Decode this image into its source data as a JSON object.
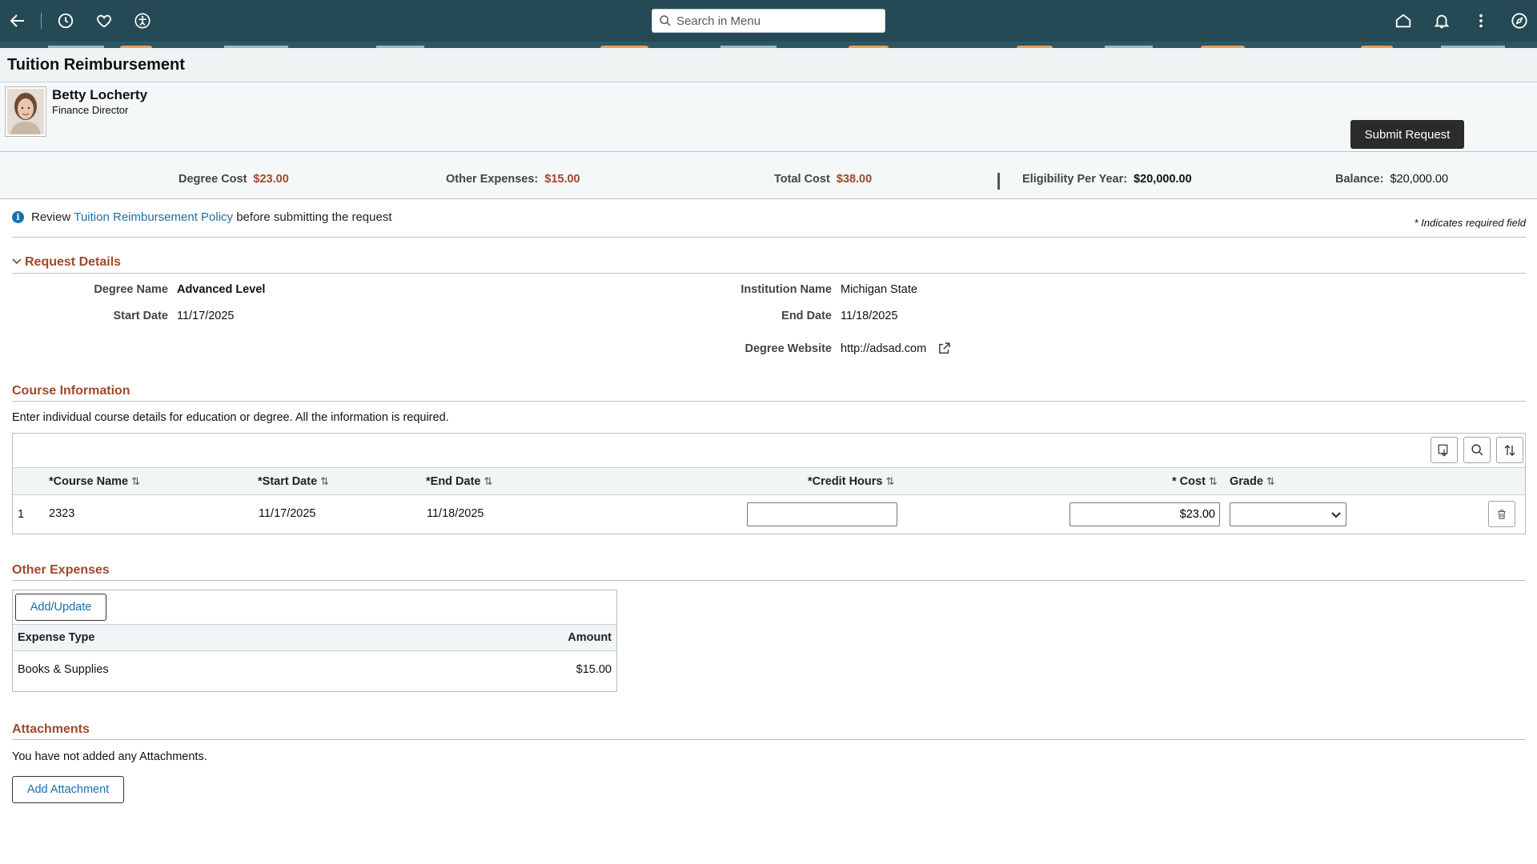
{
  "topbar": {
    "search_placeholder": "Search in Menu",
    "icons": [
      "back-arrow-icon",
      "history-icon",
      "favorites-heart-icon",
      "accessibility-icon",
      "home-icon",
      "notifications-bell-icon",
      "actions-menu-icon",
      "navigator-compass-icon"
    ]
  },
  "page": {
    "title": "Tuition Reimbursement"
  },
  "employee": {
    "name": "Betty Locherty",
    "role": "Finance Director"
  },
  "actions": {
    "submit_label": "Submit Request"
  },
  "summary": {
    "degree_cost_label": "Degree Cost",
    "degree_cost_value": "$23.00",
    "other_expenses_label": "Other Expenses:",
    "other_expenses_value": "$15.00",
    "total_cost_label": "Total Cost",
    "total_cost_value": "$38.00",
    "eligibility_label": "Eligibility Per Year:",
    "eligibility_value": "$20,000.00",
    "balance_label": "Balance:",
    "balance_value": "$20,000.00"
  },
  "info": {
    "prefix": "Review",
    "link_text": "Tuition Reimbursement Policy",
    "suffix": "before submitting the request",
    "required_note": "* Indicates required field"
  },
  "request_details": {
    "title": "Request Details",
    "degree_name_label": "Degree Name",
    "degree_name_value": "Advanced Level",
    "start_date_label": "Start Date",
    "start_date_value": "11/17/2025",
    "institution_label": "Institution Name",
    "institution_value": "Michigan State",
    "end_date_label": "End Date",
    "end_date_value": "11/18/2025",
    "website_label": "Degree Website",
    "website_value": "http://adsad.com"
  },
  "course_info": {
    "title": "Course Information",
    "description": "Enter individual course details for education or degree. All the information is required.",
    "columns": {
      "course_name": "*Course Name",
      "start_date": "*Start Date",
      "end_date": "*End Date",
      "credit_hours": "*Credit Hours",
      "cost": "* Cost",
      "grade": "Grade"
    },
    "rows": [
      {
        "num": "1",
        "course_name": "2323",
        "start_date": "11/17/2025",
        "end_date": "11/18/2025",
        "credit_hours": "",
        "cost": "$23.00",
        "grade": ""
      }
    ]
  },
  "other_expenses": {
    "title": "Other Expenses",
    "add_update_label": "Add/Update",
    "columns": {
      "type": "Expense Type",
      "amount": "Amount"
    },
    "rows": [
      {
        "type": "Books & Supplies",
        "amount": "$15.00"
      }
    ]
  },
  "attachments": {
    "title": "Attachments",
    "empty_text": "You have not added any Attachments.",
    "add_label": "Add Attachment"
  },
  "colors": {
    "topbar": "#254a55",
    "section_title": "#a0482b",
    "link": "#1a6fa8",
    "primary_button": "#2b2b2b"
  }
}
